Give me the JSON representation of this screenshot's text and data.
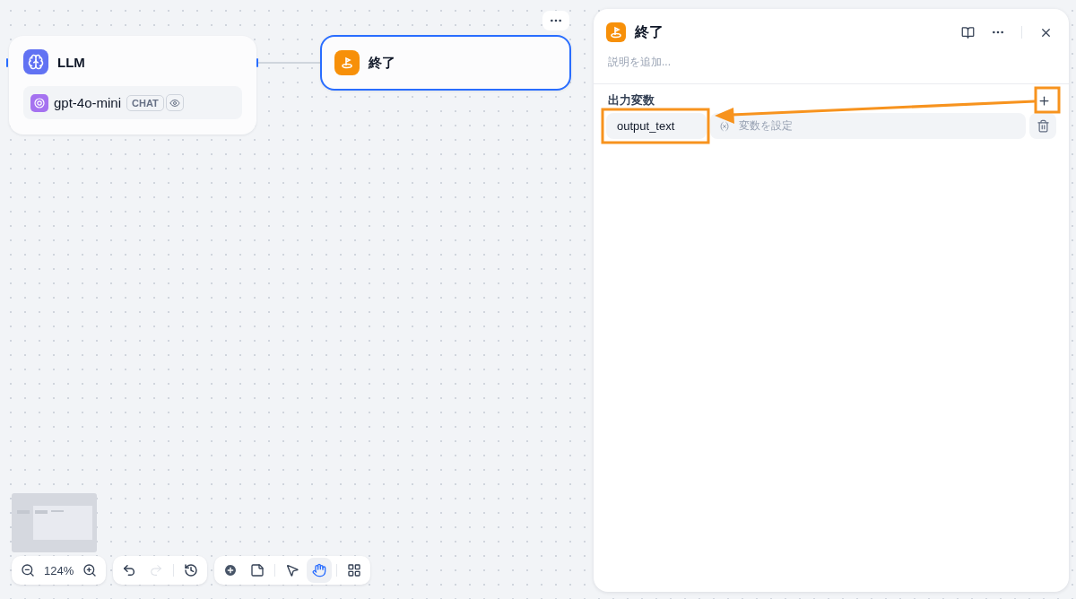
{
  "canvas": {
    "nodes": [
      {
        "kind": "llm",
        "title": "LLM",
        "model": "gpt-4o-mini",
        "badge": "CHAT",
        "selected": false
      },
      {
        "kind": "end",
        "title": "終了",
        "selected": true
      }
    ],
    "zoom": "124%",
    "history": [
      {
        "kind": "undo",
        "disabled": false
      },
      {
        "kind": "redo",
        "disabled": true
      },
      {
        "kind": "history",
        "disabled": false
      }
    ],
    "tools": [
      {
        "kind": "add",
        "selected": false
      },
      {
        "kind": "note",
        "selected": false
      },
      {
        "kind": "pointer",
        "selected": false
      },
      {
        "kind": "hand",
        "selected": true
      },
      {
        "kind": "organize",
        "selected": false
      }
    ]
  },
  "panel": {
    "title": "終了",
    "description_placeholder": "説明を追加...",
    "section": "出力変数",
    "outputs": [
      {
        "name": "output_text",
        "placeholder": "変数を設定"
      }
    ]
  }
}
